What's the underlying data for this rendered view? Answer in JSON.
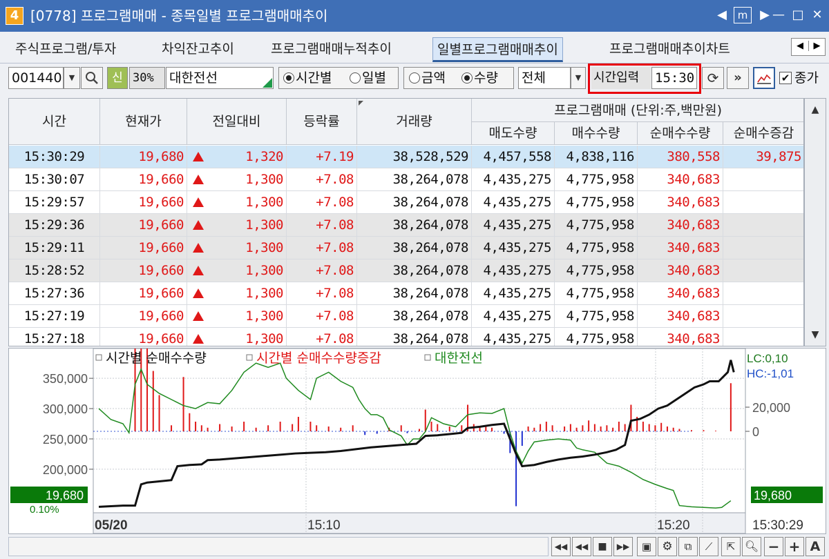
{
  "window": {
    "icon_label": "4",
    "title": "[0778]  프로그램매매  - 종목일별  프로그램매매추이",
    "controls": [
      "◀",
      "m",
      "▶",
      "—",
      "□",
      "✕"
    ]
  },
  "tabs": [
    {
      "label": "주식프로그램/투자",
      "active": false
    },
    {
      "label": "차익잔고추이",
      "active": false
    },
    {
      "label": "프로그램매매누적추이",
      "active": false
    },
    {
      "label": "일별프로그램매매추이",
      "active": true
    },
    {
      "label": "프로그램매매추이차트",
      "active": false
    }
  ],
  "tab_scroll": {
    "left": "◀",
    "right": "▶"
  },
  "toolbar": {
    "code": "001440",
    "badge_new": "신",
    "margin_rate": "30%",
    "stock_name": "대한전선",
    "radio_period": [
      {
        "label": "시간별",
        "checked": true
      },
      {
        "label": "일별",
        "checked": false
      }
    ],
    "radio_unit": [
      {
        "label": "금액",
        "checked": false
      },
      {
        "label": "수량",
        "checked": true
      }
    ],
    "filter_value": "전체",
    "time_label": "시간입력",
    "time_value": "15:30",
    "close_price_label": "종가",
    "close_price_checked": true
  },
  "table": {
    "headers": {
      "time": "시간",
      "price": "현재가",
      "change": "전일대비",
      "rate": "등락률",
      "volume": "거래량",
      "program_group": "프로그램매매 (단위:주,백만원)",
      "sell": "매도수량",
      "buy": "매수수량",
      "net": "순매수수량",
      "net_change": "순매수증감"
    },
    "rows": [
      {
        "time": "15:30:29",
        "price": "19,680",
        "change": "1,320",
        "rate": "+7.19",
        "volume": "38,528,529",
        "sell": "4,457,558",
        "buy": "4,838,116",
        "net": "380,558",
        "net_change": "39,875",
        "selected": true,
        "shade": false
      },
      {
        "time": "15:30:07",
        "price": "19,660",
        "change": "1,300",
        "rate": "+7.08",
        "volume": "38,264,078",
        "sell": "4,435,275",
        "buy": "4,775,958",
        "net": "340,683",
        "net_change": "",
        "selected": false,
        "shade": false
      },
      {
        "time": "15:29:57",
        "price": "19,660",
        "change": "1,300",
        "rate": "+7.08",
        "volume": "38,264,078",
        "sell": "4,435,275",
        "buy": "4,775,958",
        "net": "340,683",
        "net_change": "",
        "selected": false,
        "shade": false
      },
      {
        "time": "15:29:36",
        "price": "19,660",
        "change": "1,300",
        "rate": "+7.08",
        "volume": "38,264,078",
        "sell": "4,435,275",
        "buy": "4,775,958",
        "net": "340,683",
        "net_change": "",
        "selected": false,
        "shade": true
      },
      {
        "time": "15:29:11",
        "price": "19,660",
        "change": "1,300",
        "rate": "+7.08",
        "volume": "38,264,078",
        "sell": "4,435,275",
        "buy": "4,775,958",
        "net": "340,683",
        "net_change": "",
        "selected": false,
        "shade": true
      },
      {
        "time": "15:28:52",
        "price": "19,660",
        "change": "1,300",
        "rate": "+7.08",
        "volume": "38,264,078",
        "sell": "4,435,275",
        "buy": "4,775,958",
        "net": "340,683",
        "net_change": "",
        "selected": false,
        "shade": true
      },
      {
        "time": "15:27:36",
        "price": "19,660",
        "change": "1,300",
        "rate": "+7.08",
        "volume": "38,264,078",
        "sell": "4,435,275",
        "buy": "4,775,958",
        "net": "340,683",
        "net_change": "",
        "selected": false,
        "shade": false
      },
      {
        "time": "15:27:19",
        "price": "19,660",
        "change": "1,300",
        "rate": "+7.08",
        "volume": "38,264,078",
        "sell": "4,435,275",
        "buy": "4,775,958",
        "net": "340,683",
        "net_change": "",
        "selected": false,
        "shade": false
      },
      {
        "time": "15:27:18",
        "price": "19,660",
        "change": "1,300",
        "rate": "+7.08",
        "volume": "38,264,078",
        "sell": "4,435,275",
        "buy": "4,775,958",
        "net": "340,683",
        "net_change": "",
        "selected": false,
        "shade": false
      }
    ]
  },
  "colors": {
    "up": "#e01818",
    "net_line": "#111111",
    "net_change_bar": "#e01818",
    "price_line": "#1f8a1f",
    "price_tag": "#0a7a0a",
    "selected_row": "#cfe6f7",
    "shaded_row": "#e6e6e6",
    "highlight": "#e8000c"
  },
  "chart_data": {
    "type": "line",
    "legend": [
      {
        "name": "시간별 순매수수량",
        "color": "#111111"
      },
      {
        "name": "시간별 순매수수량증감",
        "color": "#e01818"
      },
      {
        "name": "대한전선",
        "color": "#1f8a1f"
      }
    ],
    "y_left_ticks": [
      "350,000",
      "300,000",
      "250,000",
      "200,000"
    ],
    "y_left_range": [
      135000,
      390000
    ],
    "y_right_ticks": [
      "20,000",
      "0"
    ],
    "y_right_range": [
      -64000,
      64000
    ],
    "right_info": {
      "lc": "LC:0,10",
      "hc": "HC:-1,01"
    },
    "price_tag_left": "19,680",
    "price_tag_right": "19,680",
    "pct_label": "0.10%",
    "x_labels": [
      "05/20",
      "15:10",
      "15:20",
      "15:30:29"
    ],
    "net_series": [
      [
        0,
        138000
      ],
      [
        4,
        139000
      ],
      [
        8,
        140000
      ],
      [
        12,
        140000
      ],
      [
        14,
        175000
      ],
      [
        16,
        178000
      ],
      [
        20,
        180000
      ],
      [
        24,
        182000
      ],
      [
        26,
        205000
      ],
      [
        30,
        207000
      ],
      [
        34,
        208000
      ],
      [
        36,
        215000
      ],
      [
        40,
        216000
      ],
      [
        45,
        218000
      ],
      [
        50,
        220000
      ],
      [
        55,
        222000
      ],
      [
        60,
        224000
      ],
      [
        65,
        226000
      ],
      [
        70,
        227000
      ],
      [
        75,
        228000
      ],
      [
        80,
        230000
      ],
      [
        85,
        233000
      ],
      [
        90,
        236000
      ],
      [
        95,
        238000
      ],
      [
        100,
        240000
      ],
      [
        105,
        242000
      ],
      [
        108,
        255000
      ],
      [
        112,
        256000
      ],
      [
        116,
        258000
      ],
      [
        120,
        260000
      ],
      [
        122,
        268000
      ],
      [
        126,
        270000
      ],
      [
        130,
        273000
      ],
      [
        134,
        275000
      ],
      [
        138,
        225000
      ],
      [
        140,
        205000
      ],
      [
        144,
        207000
      ],
      [
        148,
        212000
      ],
      [
        152,
        216000
      ],
      [
        156,
        219000
      ],
      [
        160,
        221000
      ],
      [
        164,
        224000
      ],
      [
        168,
        228000
      ],
      [
        171,
        232000
      ],
      [
        174,
        240000
      ],
      [
        176,
        280000
      ],
      [
        179,
        283000
      ],
      [
        182,
        290000
      ],
      [
        185,
        300000
      ],
      [
        188,
        305000
      ],
      [
        191,
        315000
      ],
      [
        194,
        325000
      ],
      [
        197,
        335000
      ],
      [
        200,
        340000
      ],
      [
        202,
        345000
      ],
      [
        205,
        345000
      ],
      [
        208,
        360000
      ],
      [
        209,
        380000
      ],
      [
        210,
        360000
      ]
    ],
    "price_series": [
      [
        0,
        300000
      ],
      [
        4,
        282000
      ],
      [
        8,
        275000
      ],
      [
        10,
        260000
      ],
      [
        12,
        340000
      ],
      [
        14,
        365000
      ],
      [
        16,
        340000
      ],
      [
        20,
        325000
      ],
      [
        24,
        315000
      ],
      [
        28,
        305000
      ],
      [
        32,
        300000
      ],
      [
        36,
        310000
      ],
      [
        40,
        308000
      ],
      [
        44,
        330000
      ],
      [
        48,
        360000
      ],
      [
        52,
        375000
      ],
      [
        56,
        368000
      ],
      [
        60,
        375000
      ],
      [
        62,
        350000
      ],
      [
        66,
        330000
      ],
      [
        70,
        315000
      ],
      [
        72,
        350000
      ],
      [
        76,
        360000
      ],
      [
        80,
        345000
      ],
      [
        84,
        335000
      ],
      [
        86,
        315000
      ],
      [
        88,
        300000
      ],
      [
        90,
        290000
      ],
      [
        92,
        290000
      ],
      [
        94,
        285000
      ],
      [
        96,
        265000
      ],
      [
        98,
        260000
      ],
      [
        100,
        255000
      ],
      [
        102,
        240000
      ],
      [
        104,
        250000
      ],
      [
        106,
        250000
      ],
      [
        108,
        262000
      ],
      [
        110,
        285000
      ],
      [
        114,
        275000
      ],
      [
        118,
        270000
      ],
      [
        122,
        290000
      ],
      [
        126,
        293000
      ],
      [
        130,
        292000
      ],
      [
        134,
        300000
      ],
      [
        136,
        260000
      ],
      [
        138,
        230000
      ],
      [
        140,
        210000
      ],
      [
        142,
        230000
      ],
      [
        144,
        245000
      ],
      [
        148,
        248000
      ],
      [
        152,
        250000
      ],
      [
        156,
        248000
      ],
      [
        158,
        235000
      ],
      [
        160,
        232000
      ],
      [
        164,
        228000
      ],
      [
        168,
        210000
      ],
      [
        172,
        205000
      ],
      [
        176,
        195000
      ],
      [
        180,
        183000
      ],
      [
        184,
        175000
      ],
      [
        188,
        168000
      ],
      [
        190,
        165000
      ],
      [
        192,
        140000
      ],
      [
        196,
        138000
      ],
      [
        200,
        137000
      ],
      [
        204,
        136000
      ],
      [
        206,
        137000
      ],
      [
        209,
        148000
      ]
    ],
    "change_bars": [
      [
        12,
        225000
      ],
      [
        14,
        320000
      ],
      [
        16,
        265000
      ],
      [
        18,
        50000
      ],
      [
        20,
        30000
      ],
      [
        24,
        5000
      ],
      [
        28,
        45000
      ],
      [
        30,
        15000
      ],
      [
        32,
        8000
      ],
      [
        34,
        5000
      ],
      [
        36,
        3000
      ],
      [
        40,
        6000
      ],
      [
        44,
        4000
      ],
      [
        48,
        8000
      ],
      [
        52,
        3000
      ],
      [
        56,
        5000
      ],
      [
        60,
        8000
      ],
      [
        64,
        6000
      ],
      [
        66,
        12000
      ],
      [
        70,
        8000
      ],
      [
        72,
        5000
      ],
      [
        76,
        4000
      ],
      [
        80,
        3000
      ],
      [
        84,
        5000
      ],
      [
        88,
        -3000
      ],
      [
        92,
        -2000
      ],
      [
        96,
        3000
      ],
      [
        100,
        5000
      ],
      [
        102,
        -1500
      ],
      [
        106,
        2000
      ],
      [
        108,
        18000
      ],
      [
        110,
        8000
      ],
      [
        112,
        6000
      ],
      [
        116,
        4000
      ],
      [
        120,
        5000
      ],
      [
        122,
        22000
      ],
      [
        124,
        6000
      ],
      [
        126,
        4000
      ],
      [
        128,
        5000
      ],
      [
        130,
        3000
      ],
      [
        134,
        -2000
      ],
      [
        136,
        -18000
      ],
      [
        138,
        -62000
      ],
      [
        140,
        -12000
      ],
      [
        142,
        4000
      ],
      [
        144,
        3000
      ],
      [
        146,
        6000
      ],
      [
        148,
        8000
      ],
      [
        150,
        5000
      ],
      [
        154,
        4000
      ],
      [
        156,
        6000
      ],
      [
        158,
        3000
      ],
      [
        160,
        5000
      ],
      [
        162,
        9000
      ],
      [
        164,
        6000
      ],
      [
        166,
        4000
      ],
      [
        168,
        5000
      ],
      [
        170,
        3000
      ],
      [
        172,
        8000
      ],
      [
        174,
        6000
      ],
      [
        176,
        22000
      ],
      [
        178,
        12000
      ],
      [
        180,
        8000
      ],
      [
        182,
        6000
      ],
      [
        184,
        5000
      ],
      [
        186,
        7000
      ],
      [
        188,
        4000
      ],
      [
        190,
        3000
      ],
      [
        192,
        2000
      ],
      [
        196,
        1000
      ],
      [
        200,
        1000
      ],
      [
        204,
        500
      ],
      [
        209,
        39875
      ]
    ],
    "x_max": 212
  },
  "bottom_controls": [
    "◀◀",
    "■",
    "▶▶",
    "−",
    "+",
    "A"
  ]
}
